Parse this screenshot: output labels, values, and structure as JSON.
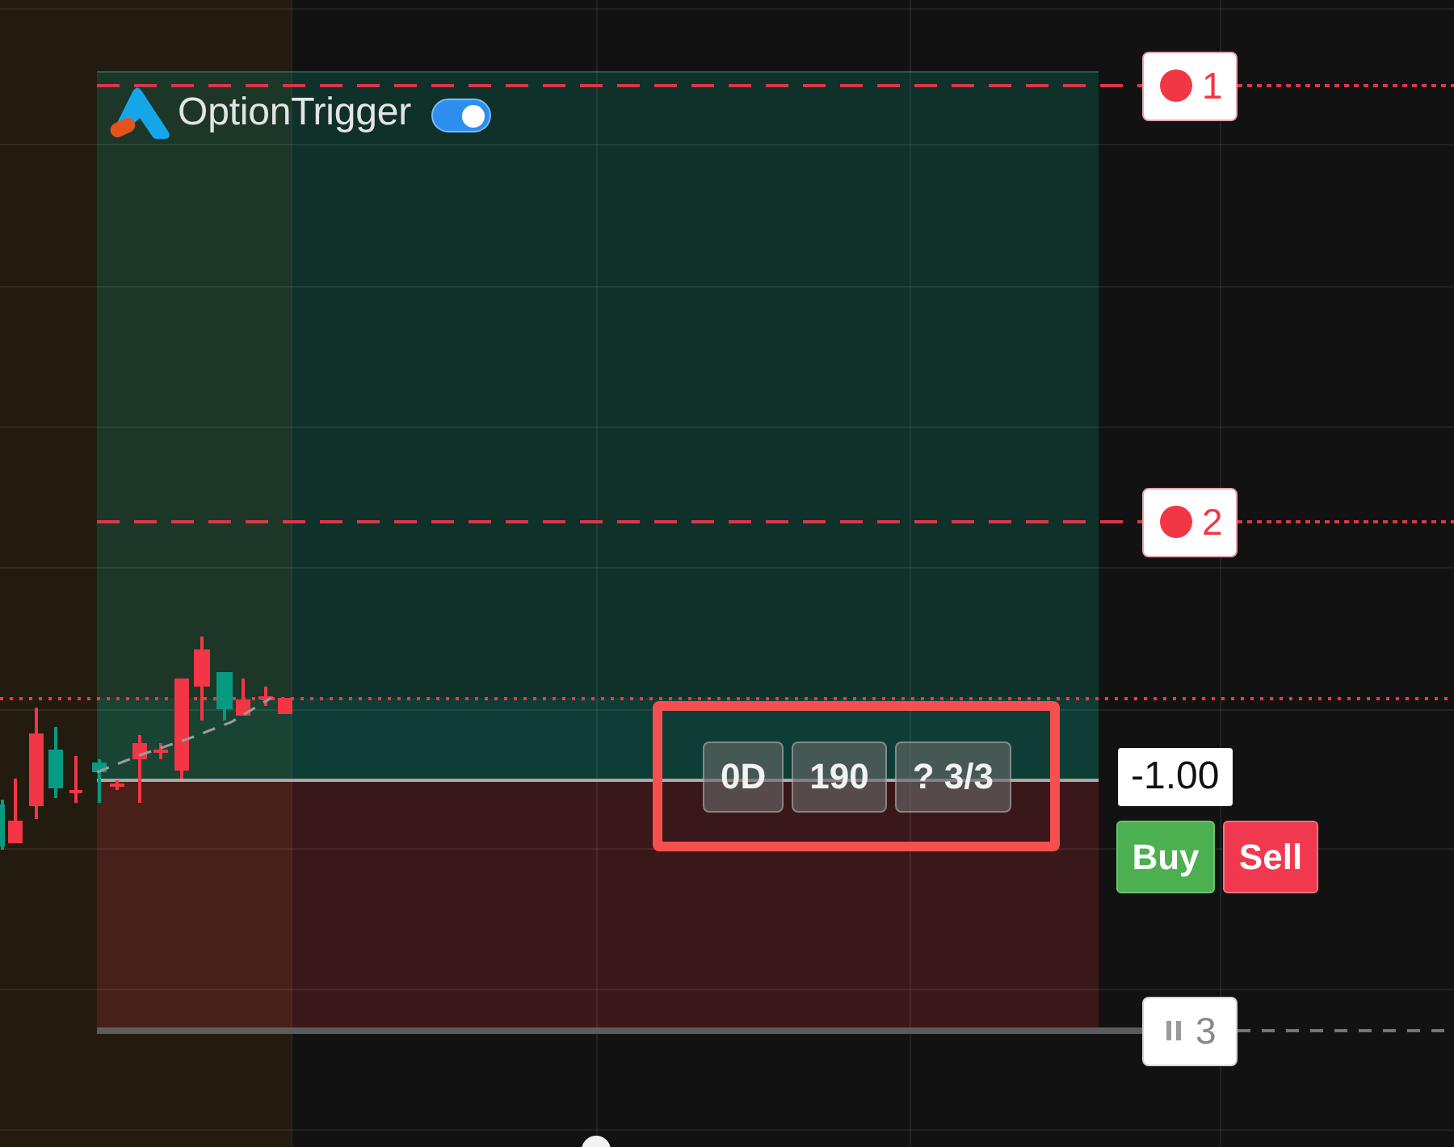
{
  "brand": {
    "name": "OptionTrigger",
    "toggle": {
      "on": true
    }
  },
  "levels": [
    {
      "kind": "target",
      "label": "1"
    },
    {
      "kind": "target",
      "label": "2"
    },
    {
      "kind": "stop",
      "label": "3"
    }
  ],
  "order_chips": [
    "0D",
    "190",
    "? 3/3"
  ],
  "quantity": "-1.00",
  "buttons": [
    {
      "kind": "buy",
      "label": "Buy"
    },
    {
      "kind": "sell",
      "label": "Sell"
    }
  ]
}
